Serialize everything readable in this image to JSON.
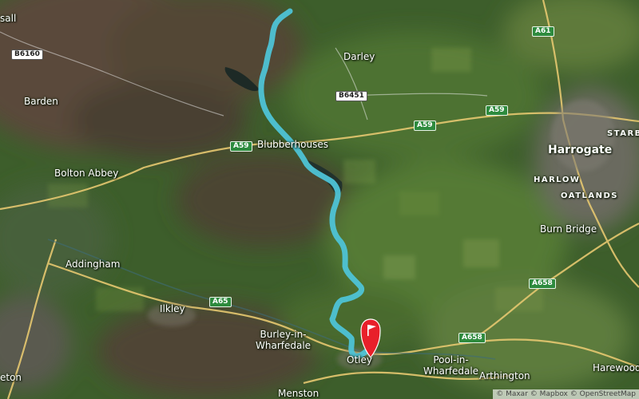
{
  "map": {
    "places": [
      {
        "id": "sall",
        "label": "sall"
      },
      {
        "id": "barden",
        "label": "Barden"
      },
      {
        "id": "darley",
        "label": "Darley"
      },
      {
        "id": "blubberhouses",
        "label": "Blubberhouses"
      },
      {
        "id": "bolton-abbey",
        "label": "Bolton Abbey"
      },
      {
        "id": "harrogate",
        "label": "Harrogate"
      },
      {
        "id": "starb",
        "label": "STARB"
      },
      {
        "id": "harlow",
        "label": "HARLOW"
      },
      {
        "id": "oatlands",
        "label": "OATLANDS"
      },
      {
        "id": "burn-bridge",
        "label": "Burn Bridge"
      },
      {
        "id": "addingham",
        "label": "Addingham"
      },
      {
        "id": "ilkley",
        "label": "Ilkley"
      },
      {
        "id": "burley",
        "label": "Burley-in-\nWharfedale"
      },
      {
        "id": "otley",
        "label": "Otley"
      },
      {
        "id": "pool",
        "label": "Pool-in-\nWharfedale"
      },
      {
        "id": "arthington",
        "label": "Arthington"
      },
      {
        "id": "harewood",
        "label": "Harewood"
      },
      {
        "id": "menston",
        "label": "Menston"
      },
      {
        "id": "eton",
        "label": "eton"
      }
    ],
    "road_shields": [
      {
        "id": "b6160",
        "label": "B6160",
        "kind": "b"
      },
      {
        "id": "b6451",
        "label": "B6451",
        "kind": "b"
      },
      {
        "id": "a61",
        "label": "A61",
        "kind": "a"
      },
      {
        "id": "a59-east",
        "label": "A59",
        "kind": "a"
      },
      {
        "id": "a59-mid",
        "label": "A59",
        "kind": "a"
      },
      {
        "id": "a59-west",
        "label": "A59",
        "kind": "a"
      },
      {
        "id": "a65",
        "label": "A65",
        "kind": "a"
      },
      {
        "id": "a658-north",
        "label": "A658",
        "kind": "a"
      },
      {
        "id": "a658-south",
        "label": "A658",
        "kind": "a"
      }
    ],
    "route_color": "#4ec3d6",
    "marker_color": "#e8202a",
    "attribution": "© Maxar © Mapbox © OpenStreetMap"
  }
}
